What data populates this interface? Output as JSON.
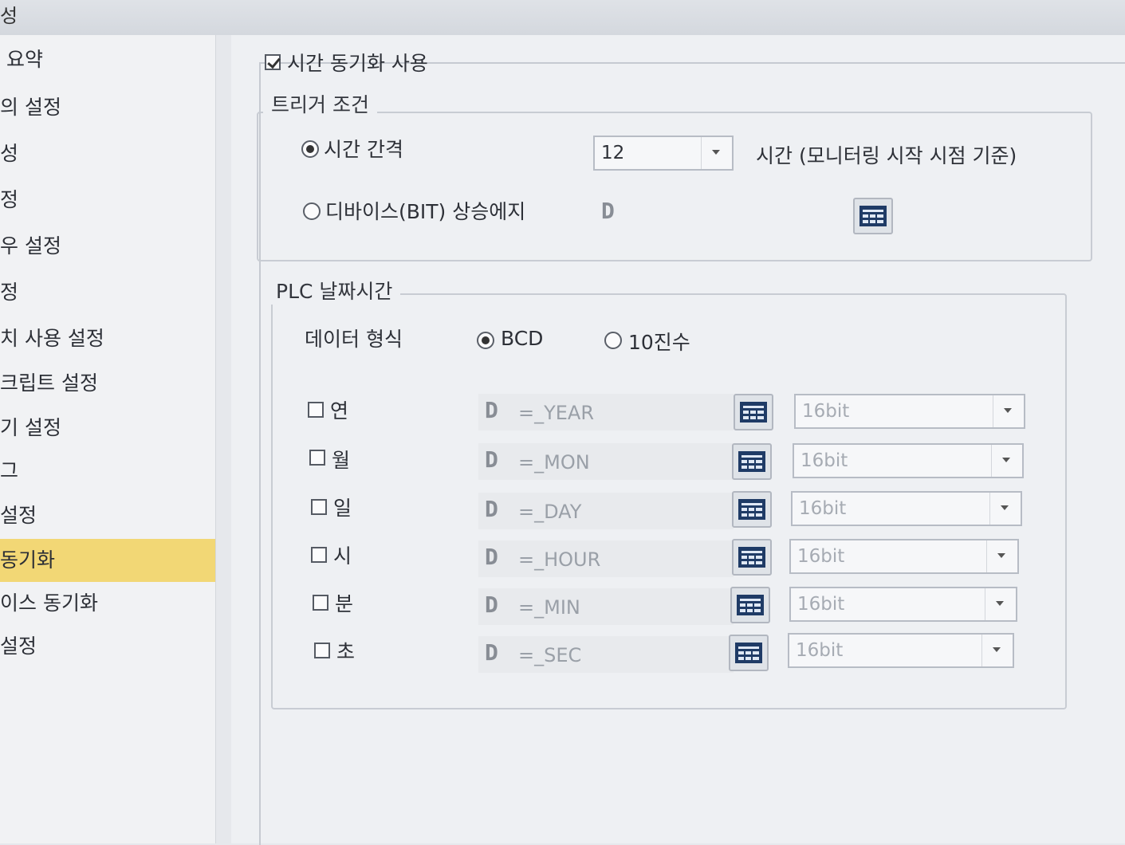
{
  "window": {
    "title_fragment": "성"
  },
  "sidebar": {
    "items": [
      {
        "label": "요약"
      },
      {
        "label": "의 설정"
      },
      {
        "label": "성"
      },
      {
        "label": "정"
      },
      {
        "label": "우 설정"
      },
      {
        "label": "정"
      },
      {
        "label": "치 사용 설정"
      },
      {
        "label": "크립트 설정"
      },
      {
        "label": "기 설정"
      },
      {
        "label": "그"
      },
      {
        "label": "설정"
      },
      {
        "label": "동기화",
        "selected": true
      },
      {
        "label": "이스 동기화"
      },
      {
        "label": "설정"
      }
    ]
  },
  "time_sync": {
    "enable_label": "시간 동기화 사용",
    "enabled": true,
    "trigger": {
      "legend": "트리거 조건",
      "interval_label": "시간 간격",
      "interval_value": "12",
      "interval_unit": "시간 (모니터링 시작 시점 기준)",
      "device_edge_label": "디바이스(BIT) 상승에지",
      "device_prefix": "D",
      "selected": "interval"
    },
    "plc": {
      "legend": "PLC 날짜시간",
      "format_label": "데이터 형식",
      "format_bcd": "BCD",
      "format_dec": "10진수",
      "selected": "bcd",
      "rows": [
        {
          "label": "연",
          "device": "D",
          "address": "=_YEAR",
          "size": "16bit"
        },
        {
          "label": "월",
          "device": "D",
          "address": "=_MON",
          "size": "16bit"
        },
        {
          "label": "일",
          "device": "D",
          "address": "=_DAY",
          "size": "16bit"
        },
        {
          "label": "시",
          "device": "D",
          "address": "=_HOUR",
          "size": "16bit"
        },
        {
          "label": "분",
          "device": "D",
          "address": "=_MIN",
          "size": "16bit"
        },
        {
          "label": "초",
          "device": "D",
          "address": "=_SEC",
          "size": "16bit"
        }
      ]
    }
  },
  "icons": {
    "tag": "tag-browser-icon"
  }
}
